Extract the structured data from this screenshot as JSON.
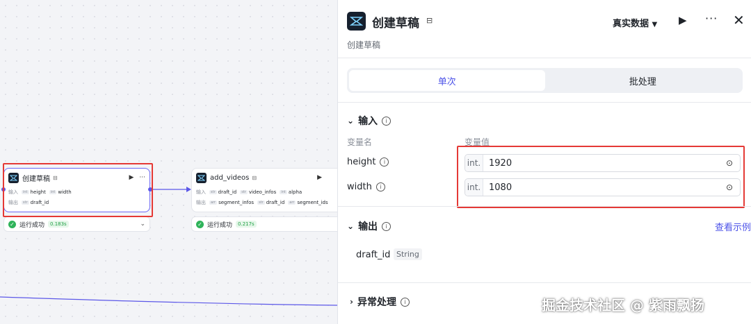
{
  "canvas": {
    "node1": {
      "title": "创建草稿",
      "input_label": "输入",
      "output_label": "输出",
      "inputs": [
        {
          "type": "int",
          "name": "height"
        },
        {
          "type": "int",
          "name": "width"
        }
      ],
      "outputs": [
        {
          "type": "str",
          "name": "draft_id"
        }
      ],
      "status": "运行成功",
      "time": "0.183s"
    },
    "node2": {
      "title": "add_videos",
      "input_label": "输入",
      "output_label": "输出",
      "inputs": [
        {
          "type": "str",
          "name": "draft_id"
        },
        {
          "type": "str",
          "name": "video_infos"
        },
        {
          "type": "int",
          "name": "alpha"
        }
      ],
      "outputs": [
        {
          "type": "arr",
          "name": "segment_infos"
        },
        {
          "type": "str",
          "name": "draft_id"
        },
        {
          "type": "arr",
          "name": "segment_ids"
        }
      ],
      "status": "运行成功",
      "time": "0.217s"
    }
  },
  "panel": {
    "title": "创建草稿",
    "description": "创建草稿",
    "data_source": "真实数据",
    "tabs": [
      "单次",
      "批处理"
    ],
    "active_tab": "单次",
    "input_section": {
      "title": "输入",
      "col_name": "变量名",
      "col_value": "变量值",
      "variables": [
        {
          "name": "height",
          "type": "int.",
          "value": "1920"
        },
        {
          "name": "width",
          "type": "int.",
          "value": "1080"
        }
      ]
    },
    "output_section": {
      "title": "输出",
      "view_example": "查看示例",
      "variables": [
        {
          "name": "draft_id",
          "type": "String"
        }
      ]
    },
    "exception_section": {
      "title": "异常处理"
    }
  },
  "watermark": "掘金技术社区 @ 紫雨飘扬",
  "colors": {
    "accent": "#4d53e8",
    "success": "#2fb35a",
    "highlight": "#e53935",
    "edge": "#5b57e8"
  }
}
